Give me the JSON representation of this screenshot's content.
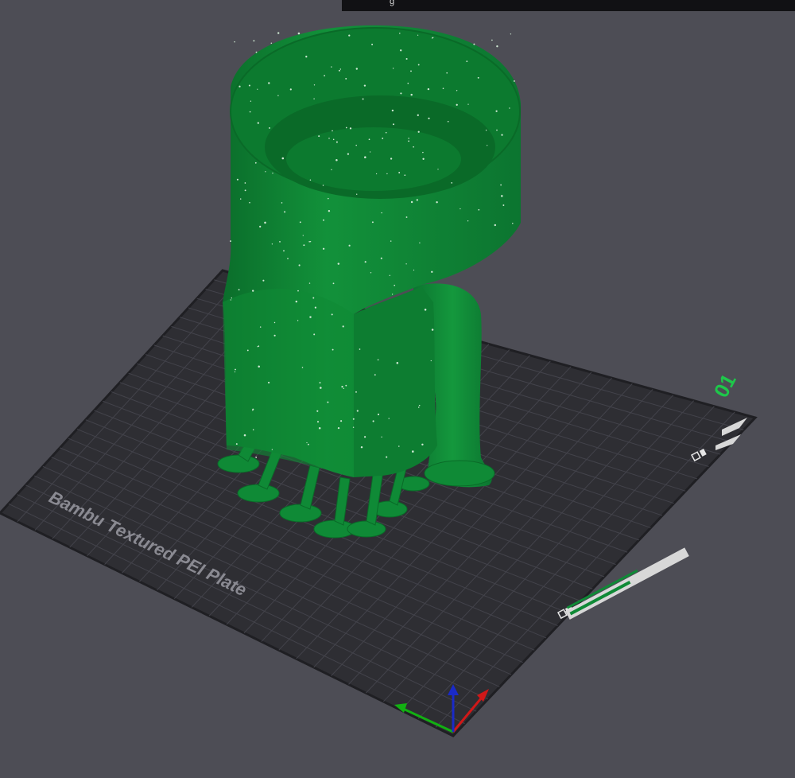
{
  "app": {
    "top_bar_text": "g"
  },
  "plate": {
    "label": "Bambu Textured PEI Plate",
    "number": "01",
    "plate_color": "#2e2e33",
    "grid_color": "#3f3f46",
    "edge_color": "#1f1f23"
  },
  "model": {
    "color": "#0f8a36",
    "color_dark": "#0a6a28",
    "color_light": "#17a244"
  },
  "axes": {
    "x_color": "#d01818",
    "y_color": "#12b012",
    "z_color": "#1a2ac8"
  },
  "icons": {
    "auto_orient": "auto-orient-icon",
    "arrange": "arrange-icon",
    "plate_settings": "plate-settings-icon",
    "lock": "lock-icon"
  }
}
